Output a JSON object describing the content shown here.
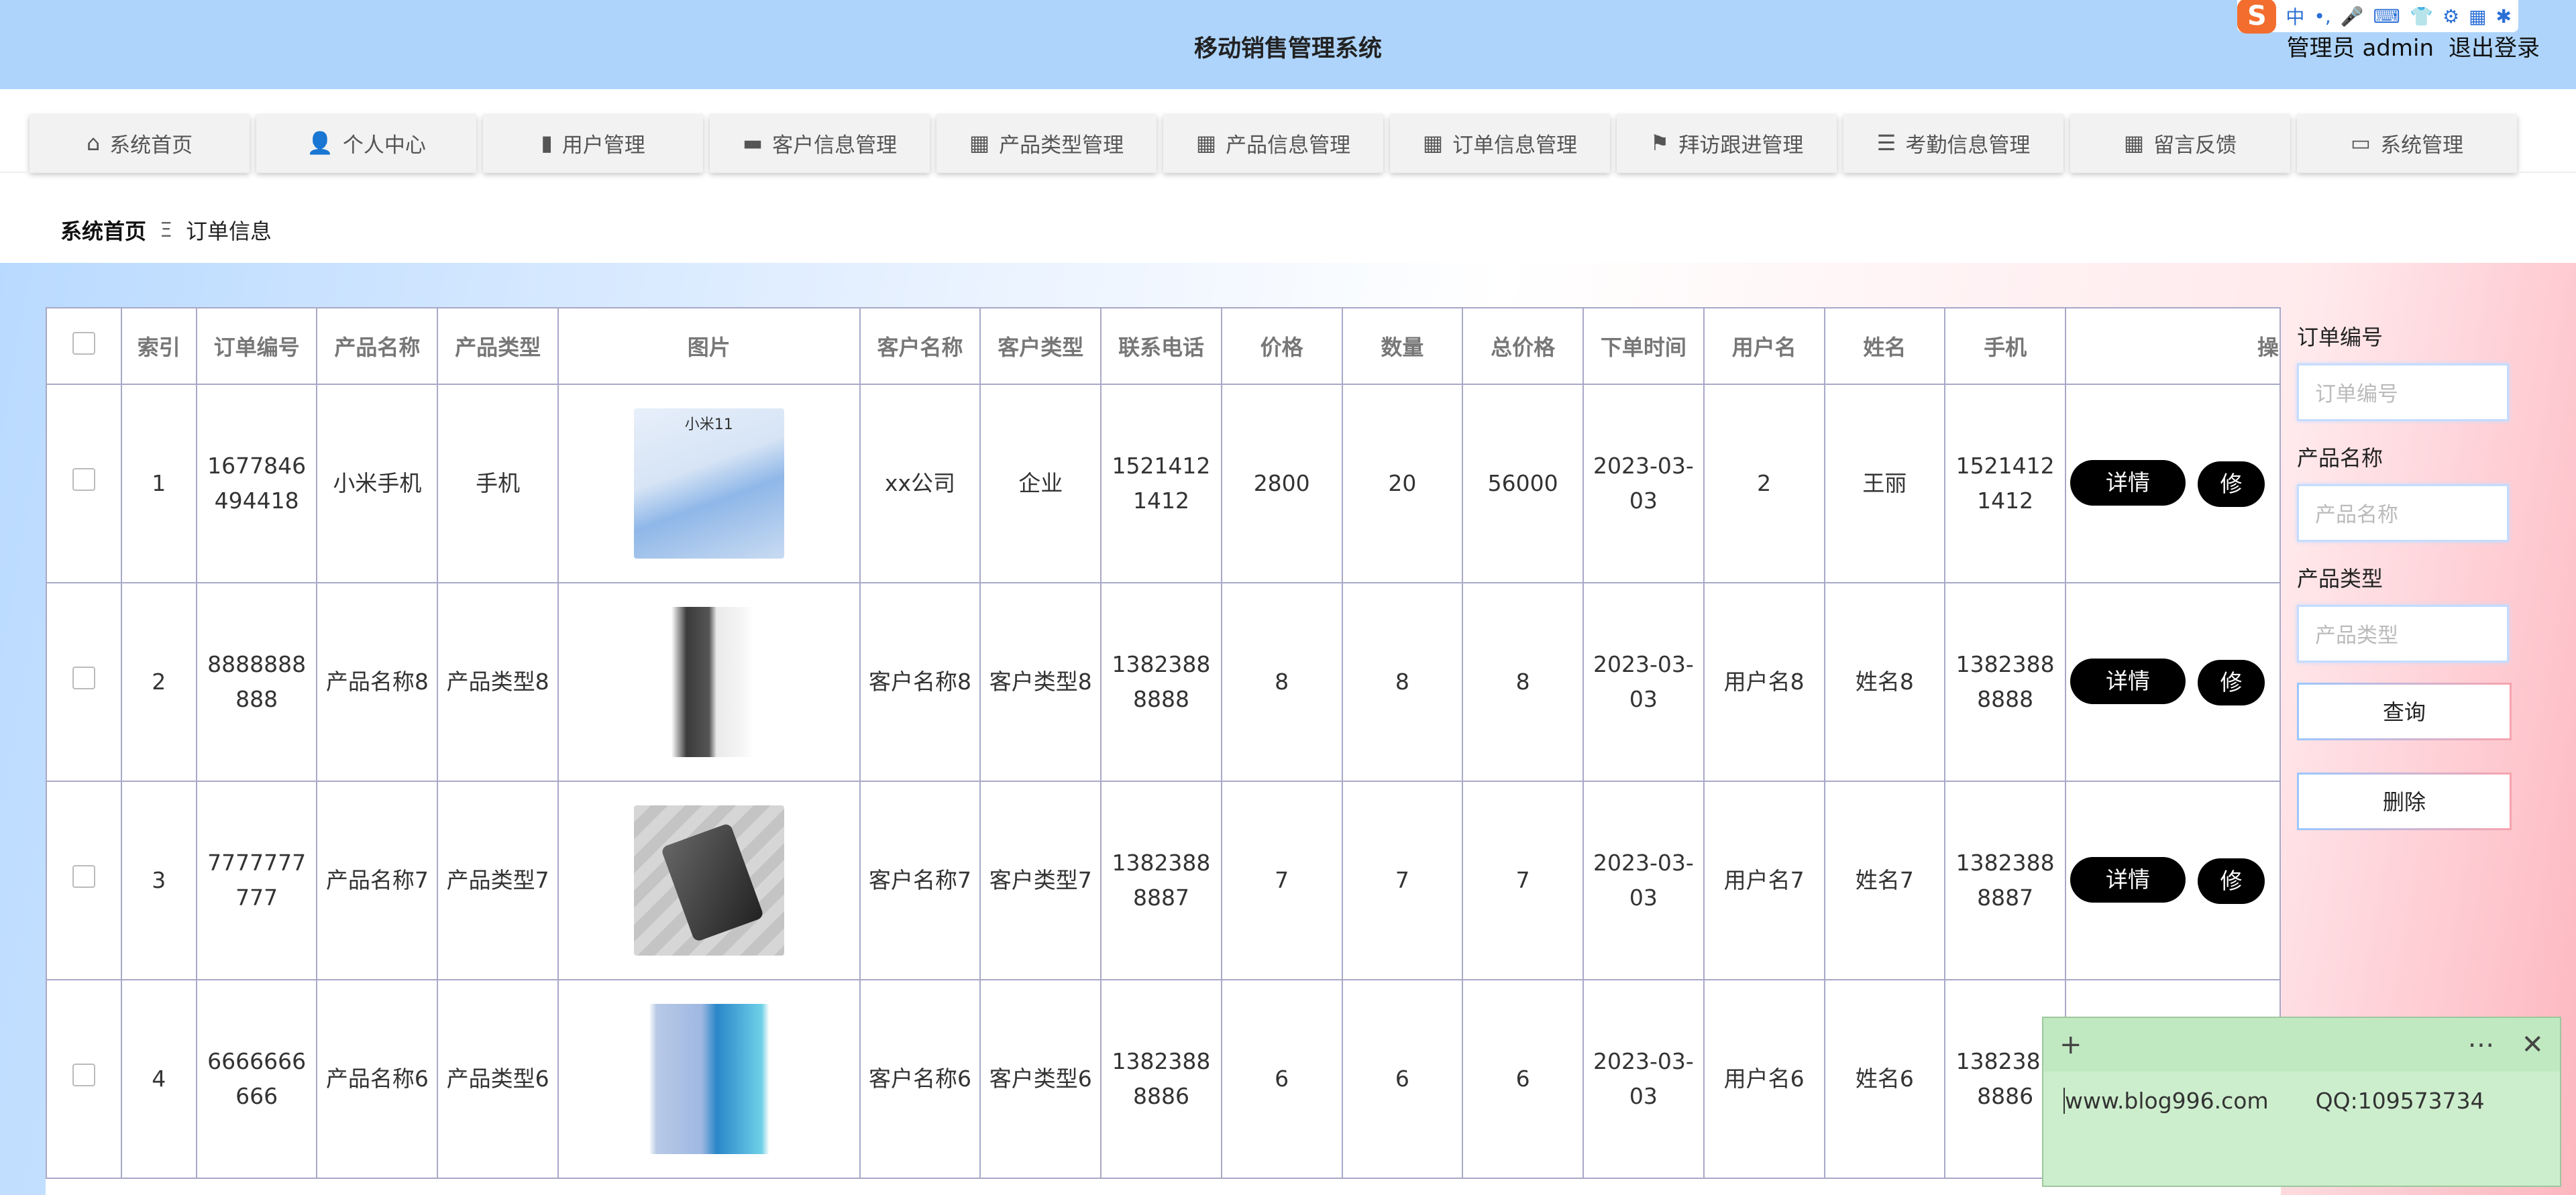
{
  "header": {
    "title": "移动销售管理系统",
    "admin_label": "管理员 admin",
    "logout_label": "退出登录",
    "ime": {
      "logo": "S",
      "glyphs": [
        "中",
        "•,",
        "🎤",
        "⌨",
        "👕",
        "⚙",
        "▦",
        "✱"
      ]
    }
  },
  "nav": [
    {
      "label": "系统首页",
      "icon": "⌂"
    },
    {
      "label": "个人中心",
      "icon": "👤"
    },
    {
      "label": "用户管理",
      "icon": "▮"
    },
    {
      "label": "客户信息管理",
      "icon": "▬"
    },
    {
      "label": "产品类型管理",
      "icon": "▦"
    },
    {
      "label": "产品信息管理",
      "icon": "▦"
    },
    {
      "label": "订单信息管理",
      "icon": "▦"
    },
    {
      "label": "拜访跟进管理",
      "icon": "⚑"
    },
    {
      "label": "考勤信息管理",
      "icon": "☰"
    },
    {
      "label": "留言反馈",
      "icon": "▦"
    },
    {
      "label": "系统管理",
      "icon": "▭"
    }
  ],
  "breadcrumb": {
    "home": "系统首页",
    "sep": "Ξ",
    "current": "订单信息"
  },
  "table": {
    "headers": [
      "索引",
      "订单编号",
      "产品名称",
      "产品类型",
      "图片",
      "客户名称",
      "客户类型",
      "联系电话",
      "价格",
      "数量",
      "总价格",
      "下单时间",
      "用户名",
      "姓名",
      "手机",
      "操"
    ],
    "rows": [
      {
        "index": "1",
        "order_no": "1677846494418",
        "product": "小米手机",
        "type": "手机",
        "image_alt": "小米11",
        "customer": "xx公司",
        "customer_type": "企业",
        "phone": "15214121412",
        "price": "2800",
        "qty": "20",
        "total": "56000",
        "date": "2023-03-03",
        "username": "2",
        "name": "王丽",
        "mobile": "15214121412"
      },
      {
        "index": "2",
        "order_no": "8888888888",
        "product": "产品名称8",
        "type": "产品类型8",
        "image_alt": "",
        "customer": "客户名称8",
        "customer_type": "客户类型8",
        "phone": "13823888888",
        "price": "8",
        "qty": "8",
        "total": "8",
        "date": "2023-03-03",
        "username": "用户名8",
        "name": "姓名8",
        "mobile": "13823888888"
      },
      {
        "index": "3",
        "order_no": "7777777777",
        "product": "产品名称7",
        "type": "产品类型7",
        "image_alt": "",
        "customer": "客户名称7",
        "customer_type": "客户类型7",
        "phone": "13823888887",
        "price": "7",
        "qty": "7",
        "total": "7",
        "date": "2023-03-03",
        "username": "用户名7",
        "name": "姓名7",
        "mobile": "13823888887"
      },
      {
        "index": "4",
        "order_no": "6666666666",
        "product": "产品名称6",
        "type": "产品类型6",
        "image_alt": "",
        "customer": "客户名称6",
        "customer_type": "客户类型6",
        "phone": "13823888886",
        "price": "6",
        "qty": "6",
        "total": "6",
        "date": "2023-03-03",
        "username": "用户名6",
        "name": "姓名6",
        "mobile": "13823888886"
      }
    ],
    "detail_label": "详情",
    "edit_label": "修"
  },
  "search": {
    "order_no_label": "订单编号",
    "order_no_placeholder": "订单编号",
    "product_label": "产品名称",
    "product_placeholder": "产品名称",
    "type_label": "产品类型",
    "type_placeholder": "产品类型",
    "query_label": "查询",
    "delete_label": "删除"
  },
  "sticky": {
    "add": "+",
    "more": "⋯",
    "close": "✕",
    "site": "www.blog996.com",
    "qq": "QQ:109573734"
  }
}
